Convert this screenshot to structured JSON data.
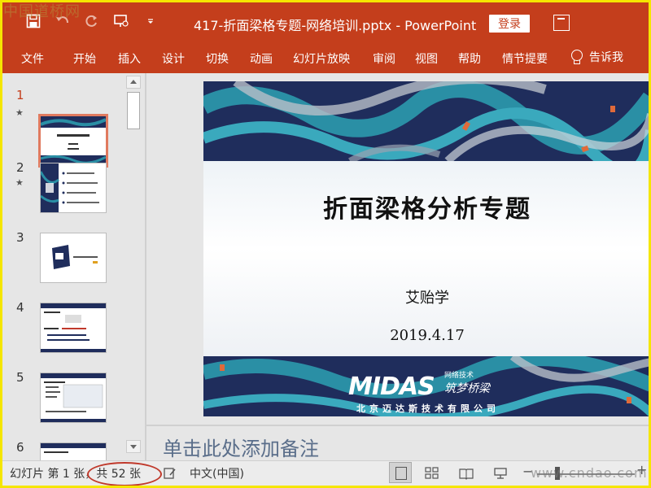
{
  "watermark_top": "中国道桥网",
  "watermark_bottom": "www.cndao.com",
  "titlebar": {
    "document_title": "417-折面梁格专题-网络培训.pptx  -  PowerPoint",
    "login_label": "登录"
  },
  "ribbon": {
    "tabs": [
      "文件",
      "开始",
      "插入",
      "设计",
      "切换",
      "动画",
      "幻灯片放映",
      "审阅",
      "视图",
      "帮助",
      "情节提要"
    ],
    "tell_me": "告诉我"
  },
  "thumbnails": [
    {
      "number": "1",
      "starred": true,
      "active": true
    },
    {
      "number": "2",
      "starred": true,
      "active": false
    },
    {
      "number": "3",
      "starred": false,
      "active": false
    },
    {
      "number": "4",
      "starred": false,
      "active": false
    },
    {
      "number": "5",
      "starred": false,
      "active": false
    },
    {
      "number": "6",
      "starred": false,
      "active": false
    }
  ],
  "slide": {
    "title": "折面梁格分析专题",
    "author": "艾贻学",
    "date": "2019.4.17",
    "logo_text": "MIDAS",
    "company": "北京迈达斯技术有限公司",
    "brand_small": "网络技术",
    "brand_script": "筑梦桥梁"
  },
  "notes_placeholder": "单击此处添加备注",
  "status": {
    "slide_count": "幻灯片 第 1 张，共 52 张",
    "language": "中文(中国)"
  },
  "colors": {
    "accent": "#c43e1c",
    "slide_dark": "#1f2d5c",
    "slide_teal": "#2a8fa5"
  }
}
